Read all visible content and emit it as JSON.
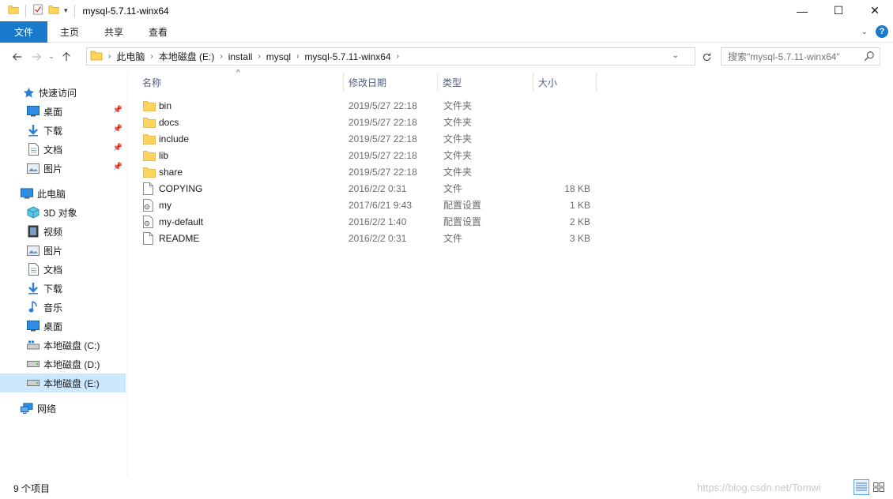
{
  "window": {
    "title": "mysql-5.7.11-winx64",
    "controls": {
      "minimize": "—",
      "maximize": "☐",
      "close": "✕"
    }
  },
  "ribbon": {
    "tabs": [
      "文件",
      "主页",
      "共享",
      "查看"
    ],
    "help": "?"
  },
  "address": {
    "crumbs": [
      "此电脑",
      "本地磁盘 (E:)",
      "install",
      "mysql",
      "mysql-5.7.11-winx64"
    ]
  },
  "search": {
    "placeholder": "搜索\"mysql-5.7.11-winx64\""
  },
  "nav": {
    "quick_access": "快速访问",
    "quick_items": [
      {
        "label": "桌面",
        "icon": "desktop-icon"
      },
      {
        "label": "下载",
        "icon": "download-icon"
      },
      {
        "label": "文档",
        "icon": "document-icon"
      },
      {
        "label": "图片",
        "icon": "picture-icon"
      }
    ],
    "this_pc": "此电脑",
    "pc_items": [
      {
        "label": "3D 对象",
        "icon": "3d-objects-icon"
      },
      {
        "label": "视频",
        "icon": "video-icon"
      },
      {
        "label": "图片",
        "icon": "picture-icon"
      },
      {
        "label": "文档",
        "icon": "document-icon"
      },
      {
        "label": "下载",
        "icon": "download-icon"
      },
      {
        "label": "音乐",
        "icon": "music-icon"
      },
      {
        "label": "桌面",
        "icon": "desktop-icon"
      },
      {
        "label": "本地磁盘 (C:)",
        "icon": "drive-c-icon"
      },
      {
        "label": "本地磁盘 (D:)",
        "icon": "drive-icon"
      },
      {
        "label": "本地磁盘 (E:)",
        "icon": "drive-icon",
        "selected": true
      }
    ],
    "network": "网络"
  },
  "columns": {
    "name": "名称",
    "date": "修改日期",
    "type": "类型",
    "size": "大小"
  },
  "files": [
    {
      "name": "bin",
      "date": "2019/5/27 22:18",
      "type": "文件夹",
      "size": "",
      "icon": "folder-icon"
    },
    {
      "name": "docs",
      "date": "2019/5/27 22:18",
      "type": "文件夹",
      "size": "",
      "icon": "folder-icon"
    },
    {
      "name": "include",
      "date": "2019/5/27 22:18",
      "type": "文件夹",
      "size": "",
      "icon": "folder-icon"
    },
    {
      "name": "lib",
      "date": "2019/5/27 22:18",
      "type": "文件夹",
      "size": "",
      "icon": "folder-icon"
    },
    {
      "name": "share",
      "date": "2019/5/27 22:18",
      "type": "文件夹",
      "size": "",
      "icon": "folder-icon"
    },
    {
      "name": "COPYING",
      "date": "2016/2/2 0:31",
      "type": "文件",
      "size": "18 KB",
      "icon": "file-icon"
    },
    {
      "name": "my",
      "date": "2017/6/21 9:43",
      "type": "配置设置",
      "size": "1 KB",
      "icon": "config-file-icon"
    },
    {
      "name": "my-default",
      "date": "2016/2/2 1:40",
      "type": "配置设置",
      "size": "2 KB",
      "icon": "config-file-icon"
    },
    {
      "name": "README",
      "date": "2016/2/2 0:31",
      "type": "文件",
      "size": "3 KB",
      "icon": "file-icon"
    }
  ],
  "status": {
    "item_count": "9 个项目",
    "watermark": "https://blog.csdn.net/Tomwi"
  },
  "colors": {
    "accent": "#1979ca",
    "folder": "#ffd45c",
    "selected": "#cce8ff"
  }
}
